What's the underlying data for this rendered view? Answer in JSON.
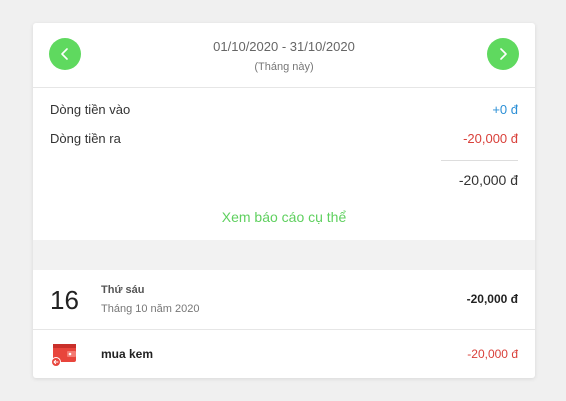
{
  "header": {
    "date_range": "01/10/2020 - 31/10/2020",
    "period_label": "(Tháng này)",
    "prev_icon": "chevron-left-icon",
    "next_icon": "chevron-right-icon"
  },
  "summary": {
    "inflow_label": "Dòng tiền vào",
    "inflow_value": "+0 đ",
    "outflow_label": "Dòng tiền ra",
    "outflow_value": "-20,000 đ",
    "total": "-20,000 đ",
    "report_link": "Xem báo cáo cụ thể"
  },
  "day_group": {
    "day_number": "16",
    "weekday": "Thứ sáu",
    "month_year": "Tháng 10 năm 2020",
    "day_total": "-20,000 đ"
  },
  "transactions": [
    {
      "name": "mua kem",
      "amount": "-20,000 đ",
      "icon": "wallet-icon"
    }
  ],
  "colors": {
    "accent_green": "#5fd95f",
    "inflow_blue": "#2b8fd6",
    "outflow_red": "#d9403a"
  }
}
